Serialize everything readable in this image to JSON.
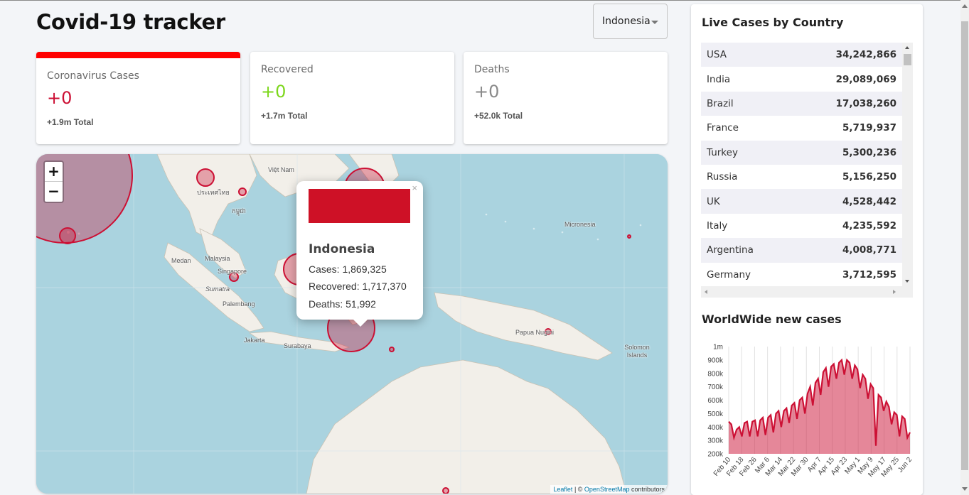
{
  "app": {
    "title": "Covid-19 tracker"
  },
  "country_select": {
    "value": "Indonesia"
  },
  "info_cards": [
    {
      "label": "Coronavirus Cases",
      "new": "+0",
      "total": "+1.9m Total",
      "color": "#cc1034",
      "active": true
    },
    {
      "label": "Recovered",
      "new": "+0",
      "total": "+1.7m Total",
      "color": "#7dd71d",
      "active": false
    },
    {
      "label": "Deaths",
      "new": "+0",
      "total": "+52.0k Total",
      "color": "#8a8a8a",
      "active": false
    }
  ],
  "map": {
    "zoom_in": "+",
    "zoom_out": "−",
    "labels": [
      "Việt Nam",
      "ประเทศไทย",
      "កម្ពុជា",
      "Malaysia",
      "Singapore",
      "Sumatra",
      "Palembang",
      "Medan",
      "Jakarta",
      "Surabaya",
      "Papua Nugini",
      "Micronesia",
      "Solomon Islands"
    ],
    "popup": {
      "close": "×",
      "country": "Indonesia",
      "flag_color": "#ce1126",
      "cases": "Cases: 1,869,325",
      "recovered": "Recovered: 1,717,370",
      "deaths": "Deaths: 51,992"
    },
    "attribution": {
      "leaflet": "Leaflet",
      "sep": " | © ",
      "osm": "OpenStreetMap",
      "tail": " contributors"
    }
  },
  "live_cases": {
    "title": "Live Cases by Country",
    "rows": [
      {
        "country": "USA",
        "cases": "34,242,866"
      },
      {
        "country": "India",
        "cases": "29,089,069"
      },
      {
        "country": "Brazil",
        "cases": "17,038,260"
      },
      {
        "country": "France",
        "cases": "5,719,937"
      },
      {
        "country": "Turkey",
        "cases": "5,300,236"
      },
      {
        "country": "Russia",
        "cases": "5,156,250"
      },
      {
        "country": "UK",
        "cases": "4,528,442"
      },
      {
        "country": "Italy",
        "cases": "4,235,592"
      },
      {
        "country": "Argentina",
        "cases": "4,008,771"
      },
      {
        "country": "Germany",
        "cases": "3,712,595"
      }
    ]
  },
  "worldwide": {
    "title": "WorldWide new cases"
  },
  "chart_data": {
    "type": "area",
    "title": "WorldWide new cases",
    "xlabel": "",
    "ylabel": "",
    "ylim": [
      200000,
      1000000
    ],
    "y_ticks": [
      "200k",
      "300k",
      "400k",
      "500k",
      "600k",
      "700k",
      "800k",
      "900k",
      "1m"
    ],
    "x_ticks": [
      "Feb 10",
      "Feb 18",
      "Feb 26",
      "Mar 6",
      "Mar 14",
      "Mar 22",
      "Mar 30",
      "Apr 7",
      "Apr 15",
      "Apr 23",
      "May 1",
      "May 9",
      "May 17",
      "May 25",
      "Jun 2"
    ],
    "color": "#cc1034",
    "fill": "rgba(204,16,52,0.5)",
    "series": [
      {
        "values": [
          440000,
          420000,
          320000,
          380000,
          400000,
          330000,
          430000,
          440000,
          330000,
          440000,
          450000,
          330000,
          450000,
          470000,
          340000,
          470000,
          490000,
          360000,
          500000,
          520000,
          400000,
          520000,
          540000,
          430000,
          560000,
          580000,
          460000,
          600000,
          620000,
          500000,
          650000,
          700000,
          560000,
          730000,
          760000,
          640000,
          810000,
          840000,
          700000,
          850000,
          870000,
          760000,
          880000,
          900000,
          790000,
          900000,
          880000,
          760000,
          860000,
          830000,
          690000,
          790000,
          760000,
          610000,
          720000,
          690000,
          260000,
          640000,
          620000,
          520000,
          590000,
          550000,
          420000,
          510000,
          490000,
          330000,
          480000,
          460000,
          320000,
          360000
        ]
      }
    ]
  }
}
